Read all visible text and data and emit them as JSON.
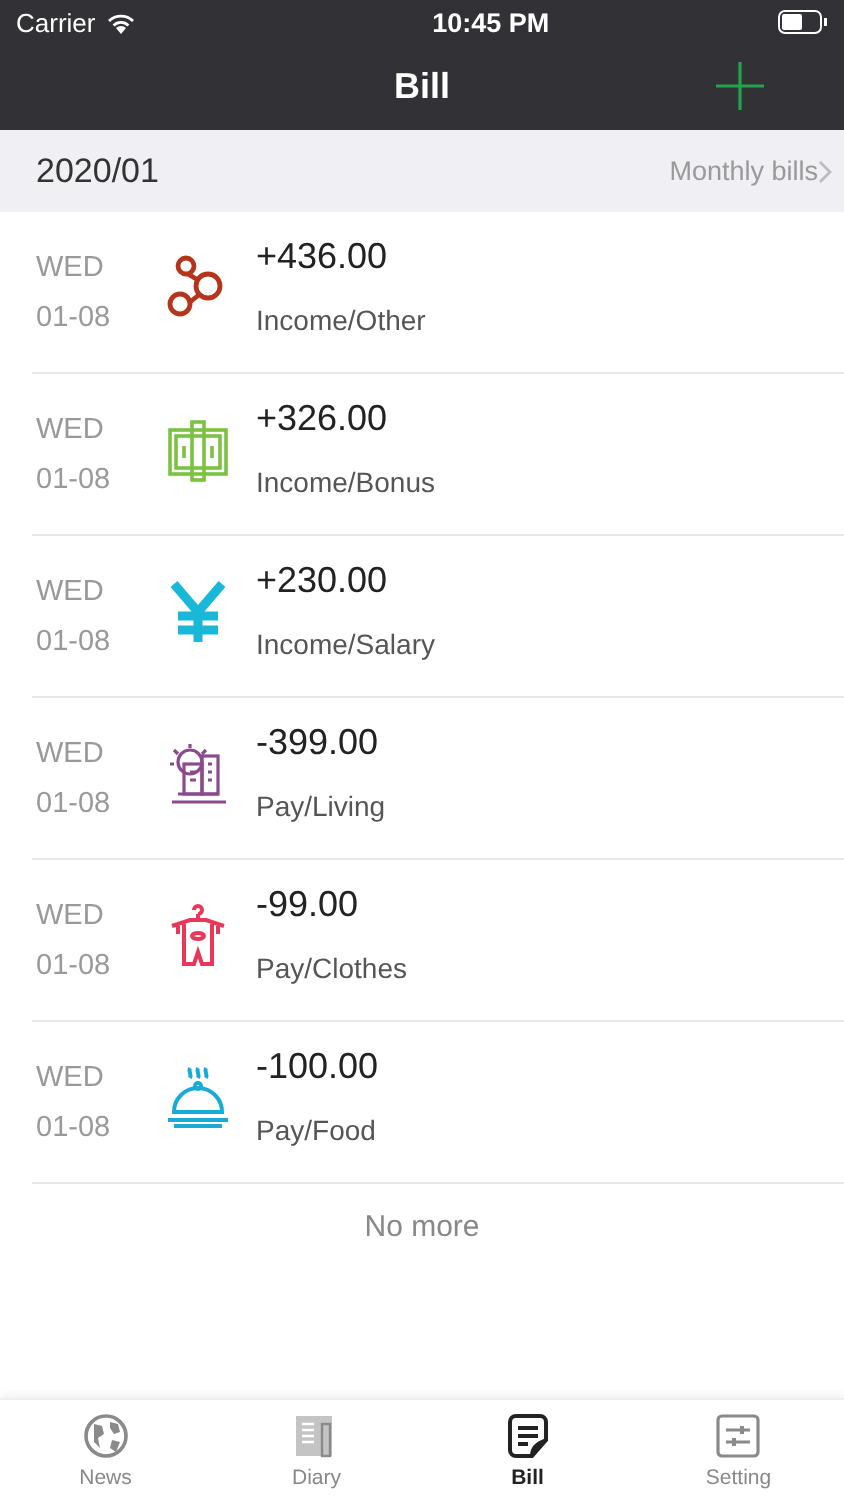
{
  "status_bar": {
    "carrier": "Carrier",
    "time": "10:45 PM"
  },
  "nav": {
    "title": "Bill"
  },
  "month": {
    "label": "2020/01",
    "link": "Monthly bills"
  },
  "entries": [
    {
      "day": "WED",
      "date": "01-08",
      "amount": "+436.00",
      "category": "Income/Other",
      "kind": "other",
      "color": "#b5351c"
    },
    {
      "day": "WED",
      "date": "01-08",
      "amount": "+326.00",
      "category": "Income/Bonus",
      "kind": "bonus",
      "color": "#7cc242"
    },
    {
      "day": "WED",
      "date": "01-08",
      "amount": "+230.00",
      "category": "Income/Salary",
      "kind": "salary",
      "color": "#1ab8d8"
    },
    {
      "day": "WED",
      "date": "01-08",
      "amount": "-399.00",
      "category": "Pay/Living",
      "kind": "living",
      "color": "#8a4a8c"
    },
    {
      "day": "WED",
      "date": "01-08",
      "amount": "-99.00",
      "category": "Pay/Clothes",
      "kind": "clothes",
      "color": "#e8385a"
    },
    {
      "day": "WED",
      "date": "01-08",
      "amount": "-100.00",
      "category": "Pay/Food",
      "kind": "food",
      "color": "#1aaad8"
    }
  ],
  "footer_note": "No more",
  "tabs": [
    {
      "label": "News",
      "kind": "globe",
      "selected": false
    },
    {
      "label": "Diary",
      "kind": "book",
      "selected": false
    },
    {
      "label": "Bill",
      "kind": "bill",
      "selected": true
    },
    {
      "label": "Setting",
      "kind": "sliders",
      "selected": false
    }
  ]
}
